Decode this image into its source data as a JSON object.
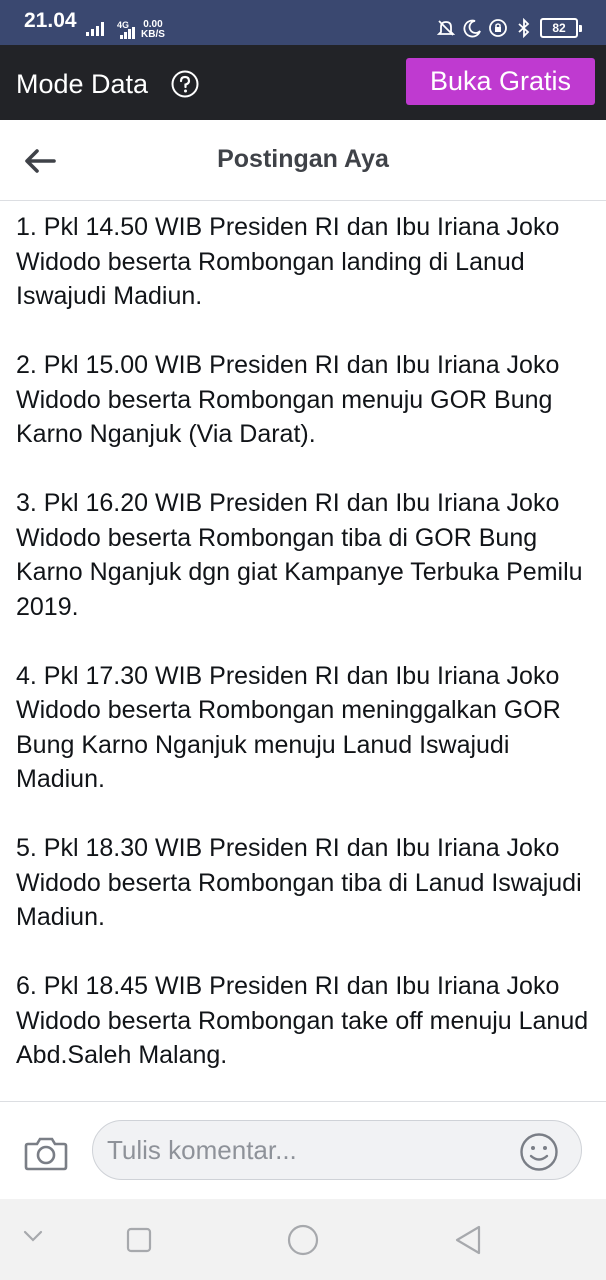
{
  "status_bar": {
    "time": "21.04",
    "network_type": "4G",
    "data_rate_value": "0.00",
    "data_rate_unit": "KB/S",
    "battery": "82",
    "icons": [
      "signal-icon",
      "mute-bell-icon",
      "moon-icon",
      "vpn-icon",
      "bluetooth-icon",
      "battery-icon"
    ]
  },
  "data_mode_bar": {
    "title": "Mode Data",
    "help_icon": "question-icon",
    "open_free_label": "Buka Gratis",
    "open_free_color": "#bf3ad0"
  },
  "header": {
    "title": "Postingan Aya",
    "back_icon": "back-arrow-icon"
  },
  "post": {
    "paragraphs": [
      "1. Pkl 14.50 WIB Presiden RI dan Ibu Iriana Joko Widodo beserta Rombongan landing di Lanud Iswajudi Madiun.",
      "2. Pkl 15.00 WIB Presiden RI dan Ibu Iriana Joko Widodo beserta Rombongan menuju GOR Bung Karno Nganjuk (Via Darat).",
      "3. Pkl 16.20 WIB Presiden RI dan Ibu Iriana Joko Widodo beserta Rombongan tiba di GOR Bung Karno Nganjuk dgn giat Kampanye Terbuka Pemilu 2019.",
      "4. Pkl 17.30 WIB Presiden RI dan Ibu Iriana Joko Widodo beserta Rombongan meninggalkan GOR Bung Karno Nganjuk menuju Lanud Iswajudi Madiun.",
      "5. Pkl 18.30 WIB Presiden RI dan Ibu Iriana Joko Widodo beserta Rombongan tiba di Lanud Iswajudi Madiun.",
      "6. Pkl 18.45 WIB Presiden RI dan Ibu Iriana Joko Widodo beserta Rombongan take off menuju Lanud Abd.Saleh Malang."
    ]
  },
  "comment_bar": {
    "placeholder": "Tulis komentar...",
    "camera_icon": "camera-icon",
    "emoji_icon": "emoji-icon"
  },
  "nav_bar": {
    "icons": [
      "chevron-down-icon",
      "recents-square-icon",
      "home-circle-icon",
      "back-triangle-icon"
    ]
  },
  "colors": {
    "status_bar_bg": "#3a4870",
    "data_bar_bg": "#222327",
    "accent_purple": "#bf3ad0"
  }
}
